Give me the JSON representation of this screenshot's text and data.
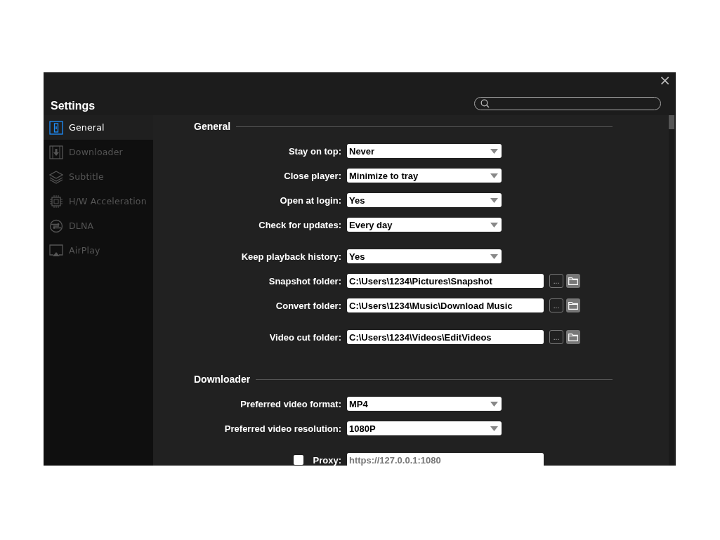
{
  "window": {
    "title": "Settings",
    "close": "×"
  },
  "sidebar": {
    "items": [
      {
        "label": "General",
        "selected": true
      },
      {
        "label": "Downloader",
        "selected": false
      },
      {
        "label": "Subtitle",
        "selected": false
      },
      {
        "label": "H/W Acceleration",
        "selected": false
      },
      {
        "label": "DLNA",
        "selected": false
      },
      {
        "label": "AirPlay",
        "selected": false
      }
    ]
  },
  "sections": [
    {
      "title": "General",
      "groups": [
        [
          {
            "kind": "dropdown",
            "label": "Stay on top:",
            "value": "Never"
          },
          {
            "kind": "dropdown",
            "label": "Close player:",
            "value": "Minimize to tray"
          },
          {
            "kind": "dropdown",
            "label": "Open at login:",
            "value": "Yes"
          },
          {
            "kind": "dropdown",
            "label": "Check for updates:",
            "value": "Every day"
          }
        ],
        [
          {
            "kind": "dropdown",
            "label": "Keep playback history:",
            "value": "Yes"
          },
          {
            "kind": "folder",
            "label": "Snapshot folder:",
            "value": "C:\\Users\\1234\\Pictures\\Snapshot",
            "browse": "..."
          },
          {
            "kind": "folder",
            "label": "Convert folder:",
            "value": "C:\\Users\\1234\\Music\\Download Music",
            "browse": "..."
          }
        ],
        [
          {
            "kind": "folder",
            "label": "Video cut folder:",
            "value": "C:\\Users\\1234\\Videos\\EditVideos",
            "browse": "..."
          }
        ]
      ]
    },
    {
      "title": "Downloader",
      "groups": [
        [
          {
            "kind": "dropdown",
            "label": "Preferred video format:",
            "value": "MP4"
          },
          {
            "kind": "dropdown",
            "label": "Preferred video resolution:",
            "value": "1080P"
          }
        ],
        [
          {
            "kind": "proxy",
            "label": "Proxy:",
            "placeholder": "https://127.0.0.1:1080",
            "checked": false
          }
        ]
      ]
    }
  ]
}
